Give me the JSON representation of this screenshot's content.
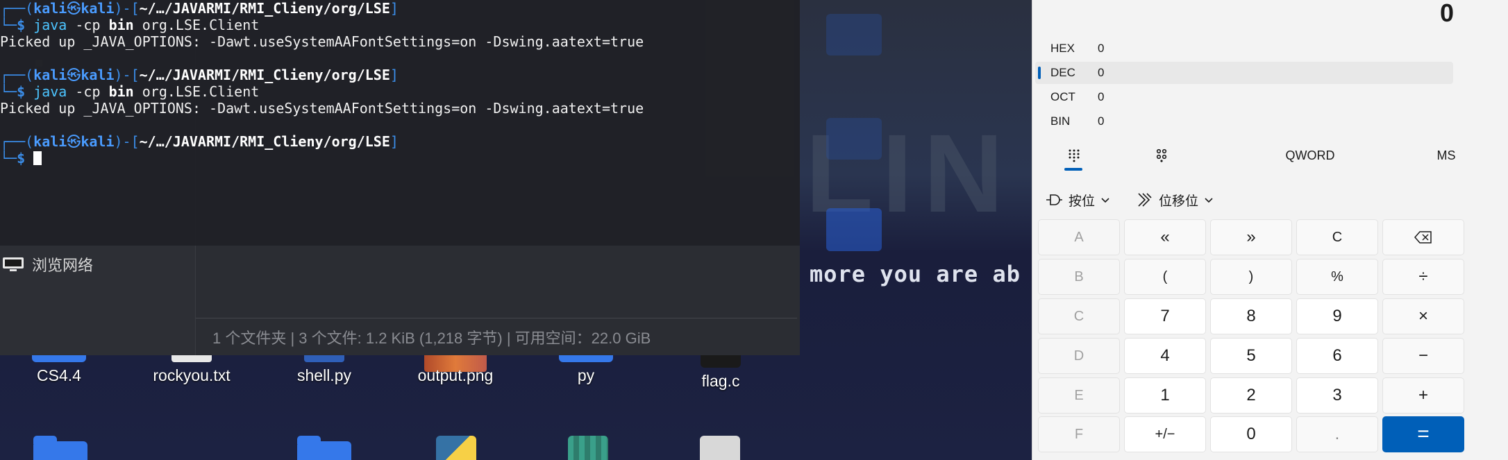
{
  "terminal": {
    "prompt_user": "kali",
    "prompt_host": "kali",
    "prompt_path": "~/…/JAVARMI/RMI_Clieny/org/LSE",
    "cmd_java": "java",
    "cmd_flag": "-cp",
    "cmd_bin": "bin",
    "cmd_class": "org.LSE.Client",
    "output_line": "Picked up _JAVA_OPTIONS: -Dawt.useSystemAAFontSettings=on -Dswing.aatext=true"
  },
  "file_manager": {
    "sidebar_browse_network": "浏览网络",
    "status_bar": "1 个文件夹 | 3 个文件: 1.2 KiB (1,218 字节) | 可用空间：22.0 GiB"
  },
  "desktop": {
    "wallpaper_text": "more you are ab",
    "icons": [
      "CS4.4",
      "rockyou.txt",
      "shell.py",
      "output.png",
      "py",
      "flag.c"
    ]
  },
  "calculator": {
    "display": "0",
    "radix": [
      {
        "name": "HEX",
        "value": "0"
      },
      {
        "name": "DEC",
        "value": "0"
      },
      {
        "name": "OCT",
        "value": "0"
      },
      {
        "name": "BIN",
        "value": "0"
      }
    ],
    "word_size": "QWORD",
    "memory": "MS",
    "bitwise_label": "按位",
    "bitshift_label": "位移位",
    "keys": {
      "hex": [
        "A",
        "B",
        "C",
        "D",
        "E",
        "F"
      ],
      "row1": [
        "«",
        "»",
        "C",
        "⌫"
      ],
      "row2": [
        "(",
        ")",
        "%",
        "÷"
      ],
      "row3": [
        "7",
        "8",
        "9",
        "×"
      ],
      "row4": [
        "4",
        "5",
        "6",
        "−"
      ],
      "row5": [
        "1",
        "2",
        "3",
        "+"
      ],
      "row6": [
        "+/−",
        "0",
        ".",
        "="
      ]
    },
    "accent_color": "#005fb8"
  }
}
